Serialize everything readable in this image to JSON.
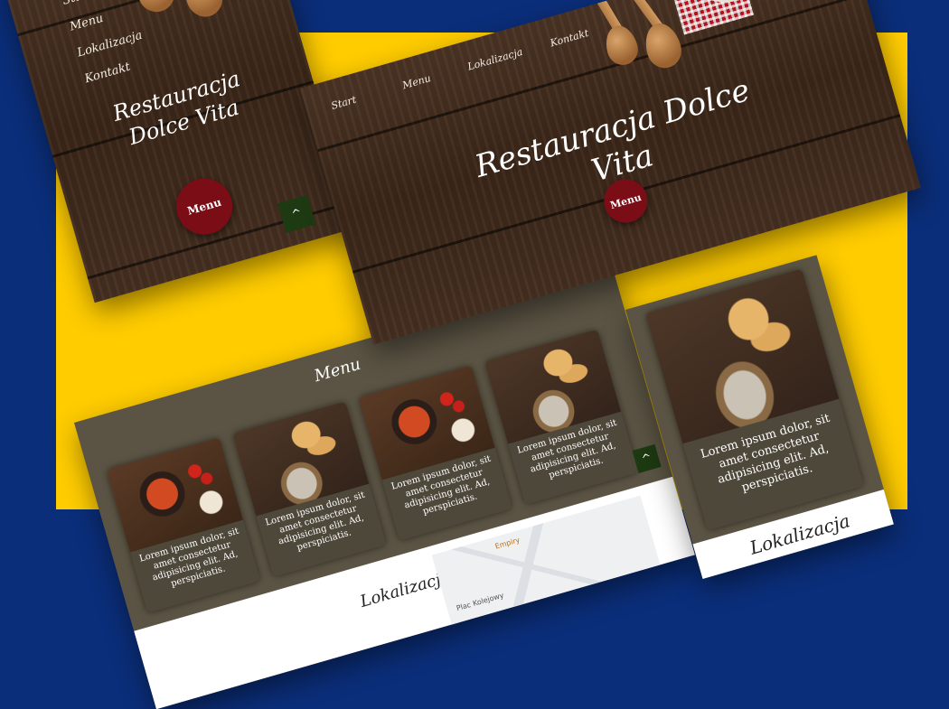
{
  "nav": [
    "Start",
    "Menu",
    "Lokalizacja",
    "Kontakt"
  ],
  "hero_title": "Restauracja Dolce Vita",
  "menu_button": "Menu",
  "scroll_top": "^",
  "menu_section_title": "Menu",
  "card_text": "Lorem ipsum dolor, sit amet consectetur adipisicing elit. Ad, perspiciatis.",
  "location_title": "Lokalizacja",
  "map": {
    "label_top": "Empiry",
    "label_bottom": "Plac Kolejowy"
  },
  "colors": {
    "background": "#0b2e7a",
    "accent": "#ffcc00",
    "button": "#7a0d16",
    "panel": "#5b5444",
    "up_button": "#1d3a12"
  }
}
